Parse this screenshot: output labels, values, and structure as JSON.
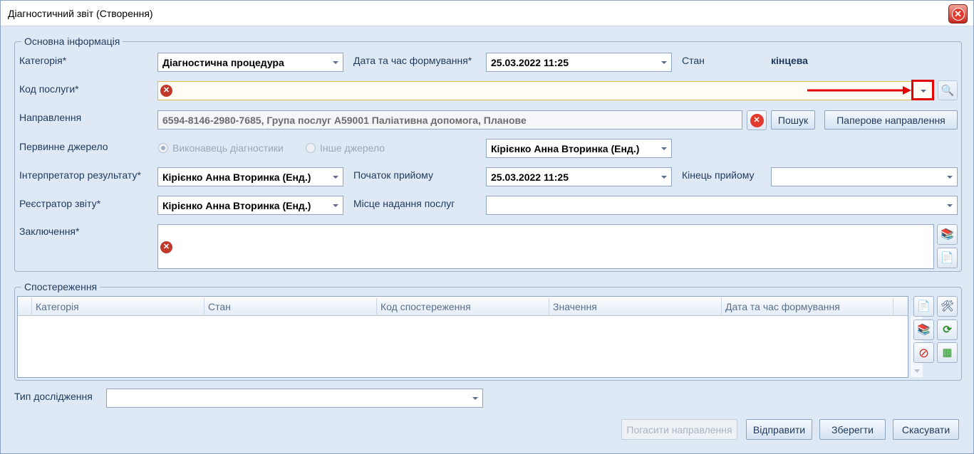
{
  "window": {
    "title": "Діагностичний звіт (Створення)"
  },
  "main_group": {
    "title": "Основна інформація",
    "category": {
      "label": "Категорія*",
      "value": "Діагностична процедура"
    },
    "formed_at": {
      "label": "Дата та час формування*",
      "value": "25.03.2022 11:25"
    },
    "state": {
      "label": "Стан",
      "value": "кінцева"
    },
    "service_code": {
      "label": "Код послуги*",
      "value": ""
    },
    "referral": {
      "label": "Направлення",
      "value": "6594-8146-2980-7685, Група послуг А59001 Паліативна допомога, Планове",
      "search_label": "Пошук",
      "paper_label": "Паперове направлення"
    },
    "primary_source": {
      "label": "Первинне джерело",
      "option_performer": "Виконавець діагностики",
      "option_other": "Інше джерело",
      "value": "Кірієнко Анна Вторинка (Енд.)"
    },
    "interpreter": {
      "label": "Інтерпретатор результату*",
      "value": "Кірієнко Анна Вторинка (Енд.)"
    },
    "start": {
      "label": "Початок прийому",
      "value": "25.03.2022 11:25"
    },
    "end": {
      "label": "Кінець прийому",
      "value": ""
    },
    "registrar": {
      "label": "Реєстратор звіту*",
      "value": "Кірієнко Анна Вторинка (Енд.)"
    },
    "place": {
      "label": "Місце надання послуг",
      "value": ""
    },
    "conclusion": {
      "label": "Заключення*",
      "value": ""
    }
  },
  "observations": {
    "title": "Спостереження",
    "columns": [
      "Категорія",
      "Стан",
      "Код спостереження",
      "Значення",
      "Дата та час формування"
    ],
    "rows": []
  },
  "study_type": {
    "label": "Тип дослідження",
    "value": ""
  },
  "footer": {
    "cancel_referral_label": "Погасити направлення",
    "send_label": "Відправити",
    "save_label": "Зберегти",
    "cancel_label": "Скасувати"
  },
  "colors": {
    "accent": "#1e395b",
    "error": "#c0392b",
    "highlight": "#e30000"
  }
}
